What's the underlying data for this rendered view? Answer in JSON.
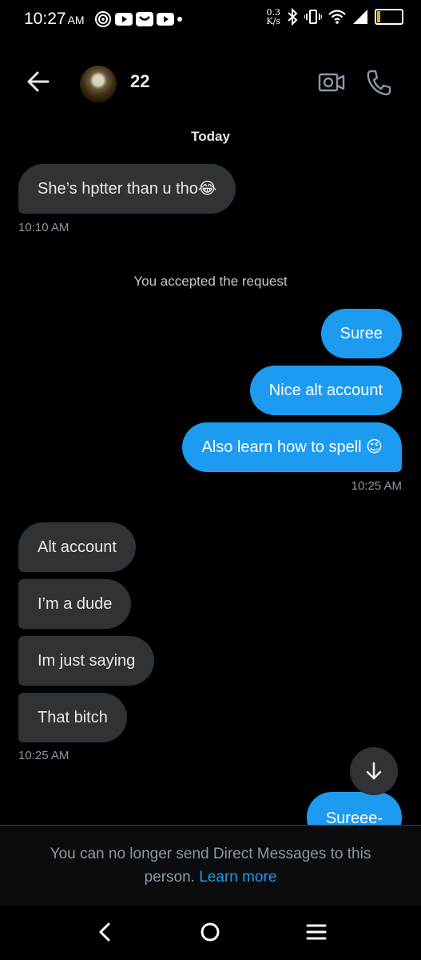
{
  "status_bar": {
    "time": "10:27",
    "ampm": "AM",
    "net_speed_value": "0.3",
    "net_speed_unit": "K/s",
    "battery": "15",
    "battery_level": 0.15,
    "battery_color": "#e8b400"
  },
  "header": {
    "name": "22",
    "back_icon": "arrow-left-icon",
    "video_icon": "video-camera-icon",
    "call_icon": "phone-icon"
  },
  "conversation": {
    "day_label": "Today",
    "messages": [
      {
        "direction": "incoming",
        "text": "She’s hptter than u tho😂"
      },
      {
        "direction": "system",
        "text": "You accepted the request"
      },
      {
        "direction": "outgoing",
        "text": "Suree"
      },
      {
        "direction": "outgoing",
        "text": "Nice alt account"
      },
      {
        "direction": "outgoing",
        "text": "Also learn how to spell 😉"
      },
      {
        "direction": "incoming",
        "text": "Alt account"
      },
      {
        "direction": "incoming",
        "text": "I’m a dude"
      },
      {
        "direction": "incoming",
        "text": "Im just saying"
      },
      {
        "direction": "incoming",
        "text": "That bitch"
      },
      {
        "direction": "outgoing",
        "text": "Sureee-"
      }
    ],
    "timestamps": [
      "10:10 AM",
      "10:25 AM",
      "10:25 AM"
    ]
  },
  "footer": {
    "notice": "You can no longer send Direct Messages to this person.",
    "link": "Learn more"
  },
  "colors": {
    "accent": "#1d9bf0",
    "incoming_bubble": "#2f3336",
    "background": "#000000"
  }
}
